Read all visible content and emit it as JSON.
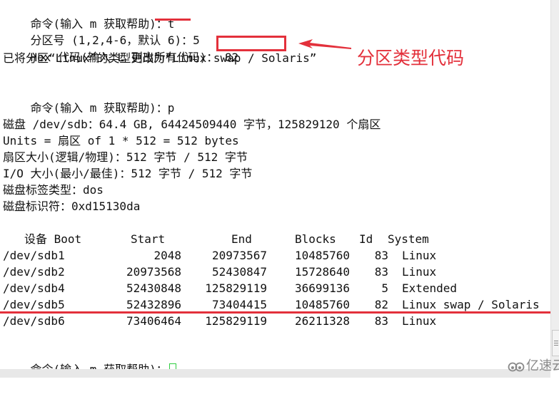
{
  "terminal": {
    "lines": {
      "cmd1_prompt": "命令(输入 m 获取帮助)：",
      "cmd1_input": "t",
      "partnum_prompt": "分区号 (1,2,4-6，默认 6)：",
      "partnum_input": "5",
      "hex_prompt": "Hex 代码(输入 L 列出所有代码)：",
      "hex_input": "82",
      "changed_msg": "已将分区“Linux”的类型更改为“Linux swap / Solaris”",
      "cmd2_prompt": "命令(输入 m 获取帮助)：",
      "cmd2_input": "p",
      "disk_info": "磁盘 /dev/sdb：64.4 GB, 64424509440 字节，125829120 个扇区",
      "units": "Units = 扇区 of 1 * 512 = 512 bytes",
      "sector_size": "扇区大小(逻辑/物理)：512 字节 / 512 字节",
      "io_size": "I/O 大小(最小/最佳)：512 字节 / 512 字节",
      "label_type": "磁盘标签类型：dos",
      "disk_id": "磁盘标识符：0xd15130da",
      "cmd3_prompt": "命令(输入 m 获取帮助)："
    },
    "partition_table": {
      "headers": {
        "device": "设备 Boot",
        "start": "Start",
        "end": "End",
        "blocks": "Blocks",
        "id": "Id",
        "system": "System"
      },
      "rows": [
        {
          "device": "/dev/sdb1",
          "start": "2048",
          "end": "20973567",
          "blocks": "10485760",
          "id": "83",
          "system": "Linux"
        },
        {
          "device": "/dev/sdb2",
          "start": "20973568",
          "end": "52430847",
          "blocks": "15728640",
          "id": "83",
          "system": "Linux"
        },
        {
          "device": "/dev/sdb4",
          "start": "52430848",
          "end": "125829119",
          "blocks": "36699136",
          "id": "5",
          "system": "Extended"
        },
        {
          "device": "/dev/sdb5",
          "start": "52432896",
          "end": "73404415",
          "blocks": "10485760",
          "id": "82",
          "system": "Linux swap / Solaris"
        },
        {
          "device": "/dev/sdb6",
          "start": "73406464",
          "end": "125829119",
          "blocks": "26211328",
          "id": "83",
          "system": "Linux"
        }
      ]
    }
  },
  "annotation": {
    "label": "分区类型代码",
    "color": "#e3303b"
  },
  "watermark": {
    "text": "亿速云"
  },
  "colors": {
    "cursor": "#2ecc40",
    "highlight": "#e3303b"
  }
}
